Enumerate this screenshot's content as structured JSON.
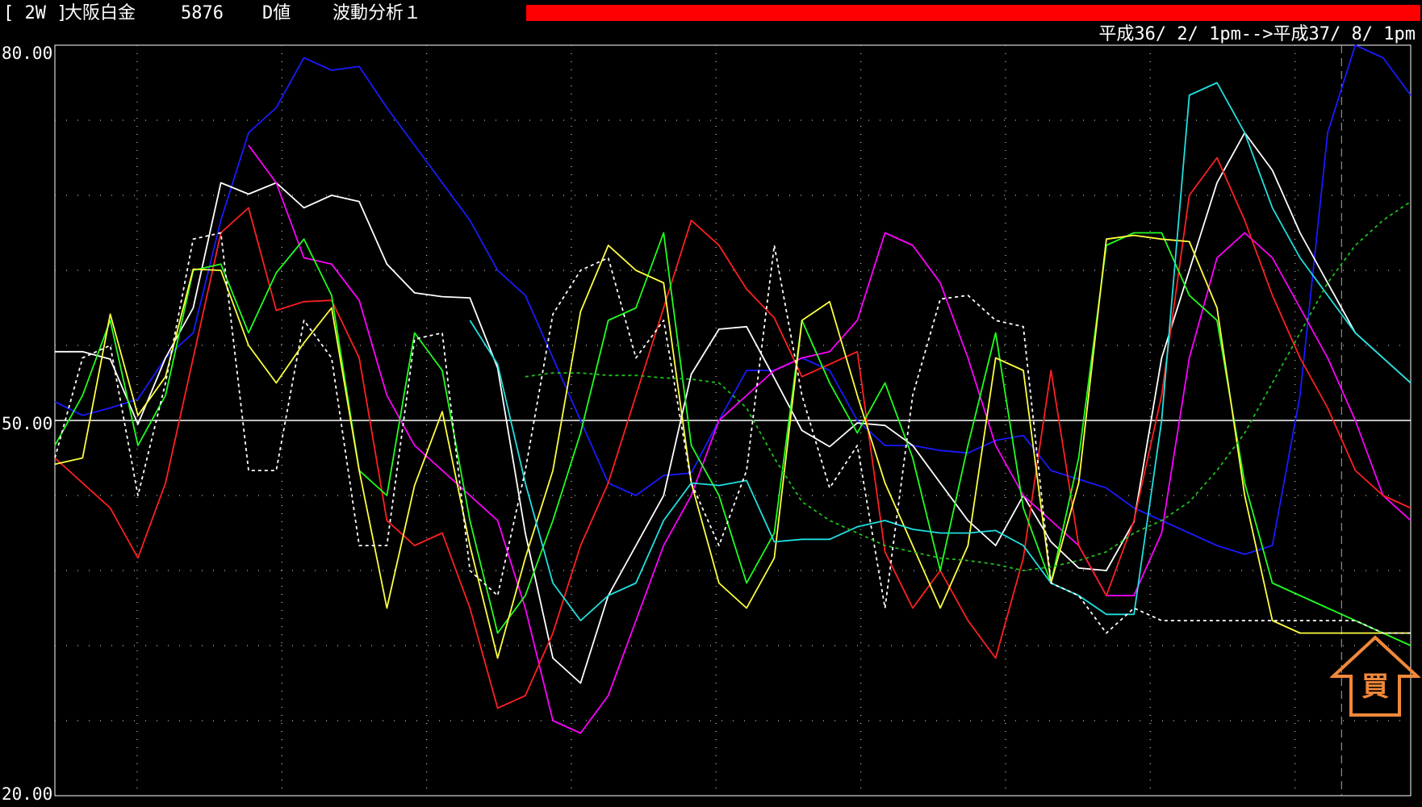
{
  "header": {
    "bracket": "[ 2W ]",
    "name": "大阪白金",
    "code": "5876",
    "value_type": "D値",
    "analysis": "波動分析１",
    "date_range": "平成36/ 2/ 1pm-->平成37/ 8/ 1pm"
  },
  "colors": {
    "background": "#000000",
    "bar": "#ff0000",
    "arrow": "#f0883a"
  },
  "buy_signal": {
    "label": "買",
    "icon": "up-arrow-icon"
  },
  "chart_data": {
    "type": "line",
    "title": "",
    "ylim": [
      20,
      80
    ],
    "yticks": [
      "80.00",
      "50.00",
      "20.00"
    ],
    "reference_line": 50,
    "grid": true,
    "n_points": 50,
    "series": [
      {
        "color": "#1a1aff",
        "dash": "",
        "values": [
          51.5,
          50.4,
          51,
          51.7,
          55,
          57,
          66,
          73,
          75,
          79,
          78,
          78.3,
          75,
          72,
          69,
          66,
          62,
          60,
          55,
          50,
          45,
          44,
          45.6,
          45.8,
          50,
          54,
          54,
          55,
          54,
          50,
          48,
          48,
          47.6,
          47.4,
          48.4,
          48.8,
          46,
          45.3,
          44.6,
          43,
          42,
          41,
          40,
          39.3,
          40,
          52,
          73,
          80,
          79,
          76,
          71
        ]
      },
      {
        "color": "#ffffff",
        "dash": "",
        "values": [
          55.5,
          55.5,
          54.9,
          49.7,
          55,
          59,
          69,
          68.1,
          69,
          67,
          68,
          67.5,
          62.5,
          60.2,
          59.9,
          59.8,
          54.2,
          41,
          31,
          29,
          36,
          40,
          44,
          53.7,
          57.3,
          57.5,
          53.4,
          49.2,
          47.9,
          49.8,
          49.6,
          48,
          45,
          42,
          40,
          44,
          40.3,
          38.2,
          38,
          41.9,
          55,
          62,
          69,
          73,
          70,
          65,
          61,
          57,
          55,
          53,
          52
        ]
      },
      {
        "color": "#ff00ff",
        "dash": "",
        "values": [
          null,
          null,
          null,
          null,
          null,
          null,
          null,
          72,
          69,
          63,
          62.5,
          59.6,
          52,
          48,
          46,
          44,
          42,
          35,
          26,
          25,
          28,
          34,
          40,
          44,
          50,
          52,
          54,
          55,
          55.5,
          58,
          65,
          64,
          61,
          55,
          48,
          44,
          42,
          40,
          36,
          36,
          41,
          55,
          63,
          65,
          63,
          59,
          55,
          50,
          44,
          42,
          40
        ]
      },
      {
        "color": "#ff2020",
        "dash": "",
        "values": [
          47,
          45,
          43,
          39,
          45,
          55,
          65,
          67,
          58.8,
          59.5,
          59.6,
          55,
          42,
          40,
          41,
          35,
          27,
          28,
          33,
          40,
          45,
          52,
          59,
          66,
          64,
          60.5,
          58.2,
          53.5,
          54.5,
          55.5,
          39.5,
          35,
          38,
          34,
          31,
          39,
          54,
          40,
          36,
          42,
          52,
          68,
          71,
          66,
          60,
          55,
          51,
          46,
          44,
          43,
          42
        ]
      },
      {
        "color": "#20ff20",
        "dash": "",
        "values": [
          48,
          52,
          58,
          48,
          52,
          62,
          62.5,
          57,
          61.8,
          64.5,
          60,
          46,
          44,
          57,
          54,
          42,
          33,
          36,
          42,
          49,
          58,
          59,
          65,
          48,
          44,
          37,
          41,
          58,
          53,
          49,
          53,
          47,
          38,
          48,
          57,
          43,
          37,
          47,
          64,
          65,
          65,
          60,
          58,
          45,
          37,
          36,
          35,
          34,
          33,
          32,
          31
        ]
      },
      {
        "color": "#ffff40",
        "dash": "",
        "values": [
          46.5,
          47,
          58.5,
          50.4,
          53.5,
          62.1,
          62,
          56,
          53,
          56.2,
          59,
          46,
          35,
          44.8,
          50.7,
          40,
          31,
          39,
          46,
          58.7,
          64,
          62,
          61,
          45,
          37,
          35,
          39,
          58,
          59.5,
          52,
          45,
          40,
          35,
          40,
          55,
          54,
          37,
          45,
          64.5,
          64.8,
          64.5,
          64.3,
          59,
          44,
          34,
          33,
          33,
          33,
          33,
          33,
          33
        ]
      },
      {
        "color": "#20e0e0",
        "dash": "",
        "values": [
          null,
          null,
          null,
          null,
          null,
          null,
          null,
          null,
          null,
          null,
          null,
          null,
          null,
          null,
          null,
          58,
          54.5,
          45,
          37,
          34,
          36,
          37,
          42,
          45,
          44.8,
          45.2,
          40.3,
          40.5,
          40.5,
          41.5,
          42,
          41.3,
          41,
          41,
          41.2,
          40,
          37,
          36,
          34.5,
          34.5,
          50,
          76,
          77,
          73,
          67,
          63,
          60,
          57,
          55,
          53,
          51
        ]
      },
      {
        "color": "#ffffff",
        "dash": "4,4",
        "values": [
          47,
          55,
          56,
          44,
          53,
          64.5,
          65,
          46,
          46,
          58,
          55,
          40,
          40,
          56.5,
          57,
          38,
          36,
          46,
          58.5,
          62,
          63,
          55,
          58,
          45,
          40,
          46,
          64,
          52,
          44.6,
          48,
          35,
          52,
          59.7,
          60,
          58,
          57.5,
          37,
          36,
          33,
          35,
          34,
          34,
          34,
          34,
          34,
          34,
          34,
          34,
          33,
          33,
          33
        ]
      },
      {
        "color": "#1fbf1f",
        "dash": "4,4",
        "values": [
          null,
          null,
          null,
          null,
          null,
          null,
          null,
          null,
          null,
          null,
          null,
          null,
          null,
          null,
          null,
          null,
          null,
          53.5,
          53.8,
          53.8,
          53.6,
          53.6,
          53.4,
          53.3,
          53,
          51,
          47,
          43.5,
          42,
          41,
          40,
          39.5,
          39,
          38.8,
          38.5,
          38,
          38.3,
          38.8,
          39.5,
          41,
          42,
          43.5,
          46,
          49,
          53,
          57,
          61,
          64,
          66,
          67.5,
          69
        ]
      }
    ]
  }
}
